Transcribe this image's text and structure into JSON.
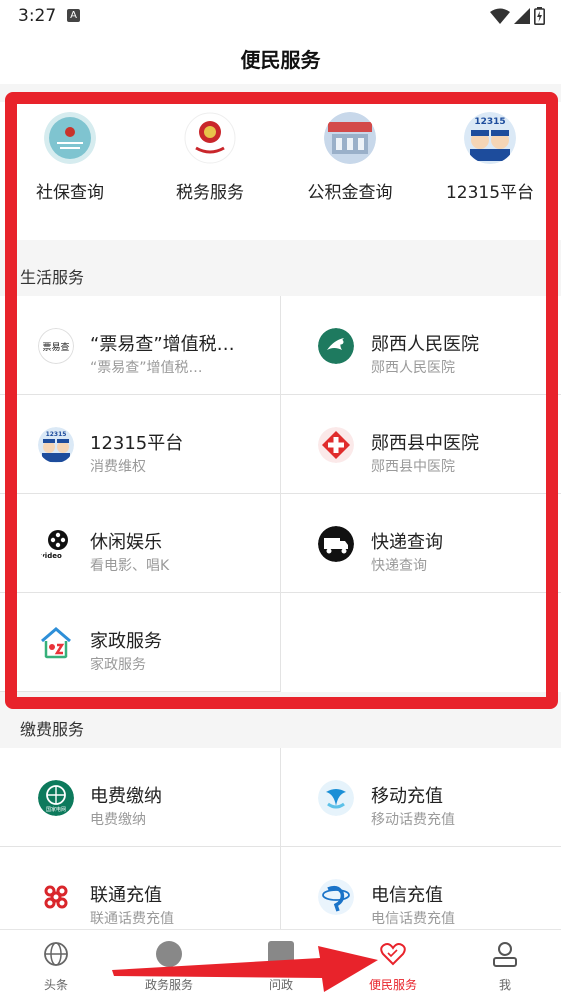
{
  "status": {
    "time": "3:27",
    "badge": "A"
  },
  "header": {
    "title": "便民服务"
  },
  "top_services": [
    {
      "label": "社保查询",
      "icon": "social-security-icon"
    },
    {
      "label": "税务服务",
      "icon": "tax-emblem-icon"
    },
    {
      "label": "公积金查询",
      "icon": "housing-fund-icon"
    },
    {
      "label": "12315平台",
      "icon": "12315-icon",
      "icon_text": "12315"
    }
  ],
  "life_section": {
    "title": "生活服务",
    "items": [
      {
        "title": "“票易查”增值税…",
        "subtitle": "“票易查”增值税…",
        "icon": "invoice-check-icon",
        "icon_text": "票易查"
      },
      {
        "title": "郧西人民医院",
        "subtitle": "郧西人民医院",
        "icon": "hospital-icon"
      },
      {
        "title": "12315平台",
        "subtitle": "消费维权",
        "icon": "12315-icon",
        "icon_text": "12315"
      },
      {
        "title": "郧西县中医院",
        "subtitle": "郧西县中医院",
        "icon": "medical-cross-icon"
      },
      {
        "title": "休闲娱乐",
        "subtitle": "看电影、唱K",
        "icon": "video-reel-icon",
        "icon_text": "video"
      },
      {
        "title": "快递查询",
        "subtitle": "快递查询",
        "icon": "delivery-truck-icon"
      },
      {
        "title": "家政服务",
        "subtitle": "家政服务",
        "icon": "housekeeping-icon"
      }
    ]
  },
  "payment_section": {
    "title": "缴费服务",
    "items": [
      {
        "title": "电费缴纳",
        "subtitle": "电费缴纳",
        "icon": "state-grid-icon",
        "icon_text": "国家电网"
      },
      {
        "title": "移动充值",
        "subtitle": "移动话费充值",
        "icon": "china-mobile-icon"
      },
      {
        "title": "联通充值",
        "subtitle": "联通话费充值",
        "icon": "china-unicom-icon"
      },
      {
        "title": "电信充值",
        "subtitle": "电信话费充值",
        "icon": "china-telecom-icon"
      }
    ]
  },
  "tabs": [
    {
      "label": "头条",
      "icon": "globe-icon",
      "active": false
    },
    {
      "label": "政务服务",
      "icon": "circle-icon",
      "active": false
    },
    {
      "label": "问政",
      "icon": "square-icon",
      "active": false
    },
    {
      "label": "便民服务",
      "icon": "heart-icon",
      "active": true
    },
    {
      "label": "我",
      "icon": "person-icon",
      "active": false
    }
  ],
  "colors": {
    "accent": "#e8232b",
    "divider": "#e3e3e3",
    "subtext": "#9a9a9a"
  }
}
